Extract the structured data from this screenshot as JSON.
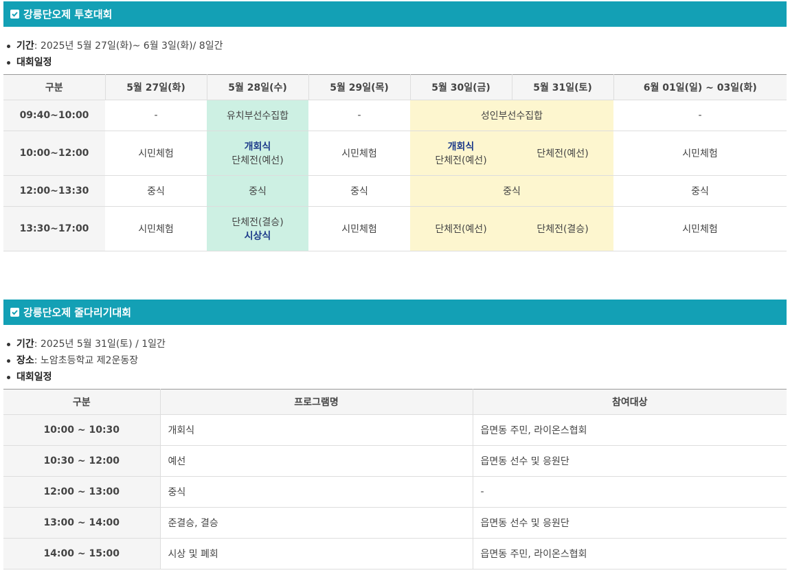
{
  "section1": {
    "title": "강릉단오제 투호대회",
    "period_label": "기간",
    "period_value": " : 2025년 5월 27일(화)~ 6월 3일(화)/ 8일간",
    "schedule_label": "대회일정",
    "headers": [
      "구분",
      "5월 27일(화)",
      "5월 28일(수)",
      "5월 29일(목)",
      "5월 30일(금)",
      "5월 31일(토)",
      "6월 01일(일) ~ 03일(화)"
    ],
    "rows": [
      {
        "time": "09:40~10:00",
        "c1": "-",
        "c2": "유치부선수집합",
        "c3": "-",
        "c4": "성인부선수집합",
        "c6": "-"
      },
      {
        "time": "10:00~12:00",
        "c1": "시민체험",
        "c2_em": "개회식",
        "c2": "단체전(예선)",
        "c3": "시민체험",
        "c4_em": "개회식",
        "c4": "단체전(예선)",
        "c5": "단체전(예선)",
        "c6": "시민체험"
      },
      {
        "time": "12:00~13:30",
        "c1": "중식",
        "c2": "중식",
        "c3": "중식",
        "c4": "중식",
        "c6": "중식"
      },
      {
        "time": "13:30~17:00",
        "c1": "시민체험",
        "c2": "단체전(결승)",
        "c2_em": "시상식",
        "c3": "시민체험",
        "c4": "단체전(예선)",
        "c5": "단체전(결승)",
        "c6": "시민체험"
      }
    ]
  },
  "section2": {
    "title": "강릉단오제 줄다리기대회",
    "period_label": "기간",
    "period_value": " : 2025년 5월 31일(토) / 1일간",
    "place_label": "장소",
    "place_value": " : 노암초등학교 제2운동장",
    "schedule_label": "대회일정",
    "headers": [
      "구분",
      "프로그램명",
      "참여대상"
    ],
    "rows": [
      {
        "time": "10:00 ~ 10:30",
        "program": "개회식",
        "target": "읍면동 주민, 라이온스협회"
      },
      {
        "time": "10:30 ~ 12:00",
        "program": "예선",
        "target": "읍면동 선수 및 응원단"
      },
      {
        "time": "12:00 ~ 13:00",
        "program": "중식",
        "target": "-"
      },
      {
        "time": "13:00 ~ 14:00",
        "program": "준결승, 결승",
        "target": "읍면동 선수 및 응원단"
      },
      {
        "time": "14:00 ~ 15:00",
        "program": "시상 및 폐회",
        "target": "읍면동 주민, 라이온스협회"
      }
    ]
  },
  "colors": {
    "section_bar": "#13a0b5",
    "green_cell": "#cdf0e3",
    "yellow_cell": "#fdf6cf",
    "emphasis": "#1d3b8a"
  },
  "icons": {
    "section_marker": "checkbox-checked-icon"
  }
}
